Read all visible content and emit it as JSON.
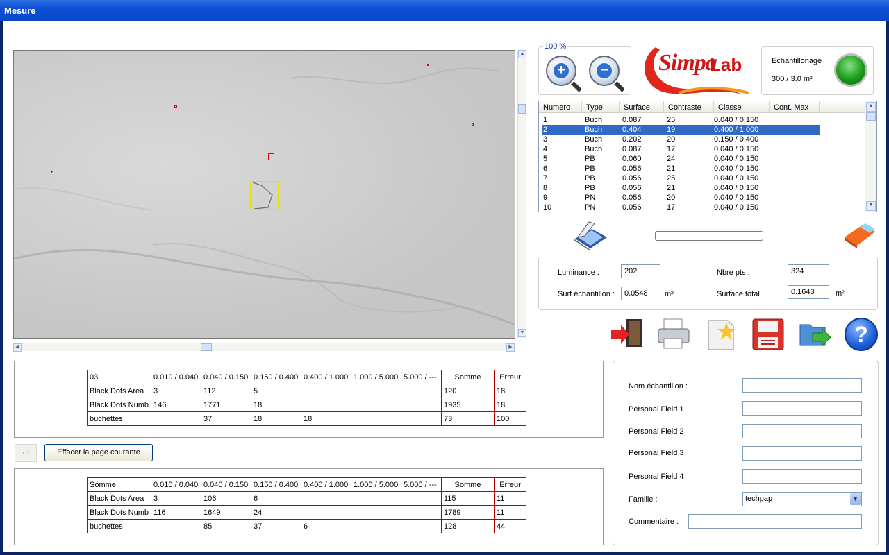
{
  "window": {
    "title": "Mesure"
  },
  "zoom": {
    "label": "100 %"
  },
  "logo": {
    "text1": "Simpa",
    "text2": "Lab"
  },
  "sampling": {
    "title": "Echantillonage",
    "value": "300 / 3.0 m²",
    "status_color": "#1c9c1c"
  },
  "results_list": {
    "columns": [
      "Numero",
      "Type",
      "Surface",
      "Contraste",
      "Classe",
      "Cont. Max"
    ],
    "selected_index": 1,
    "rows": [
      [
        "1",
        "Buch",
        "0.087",
        "25",
        "0.040 / 0.150",
        ""
      ],
      [
        "2",
        "Buch",
        "0.404",
        "19",
        "0.400 / 1.000",
        ""
      ],
      [
        "3",
        "Buch",
        "0.202",
        "20",
        "0.150 / 0.400",
        ""
      ],
      [
        "4",
        "Buch",
        "0.087",
        "17",
        "0.040 / 0.150",
        ""
      ],
      [
        "5",
        "PB",
        "0.060",
        "24",
        "0.040 / 0.150",
        ""
      ],
      [
        "6",
        "PB",
        "0.056",
        "21",
        "0.040 / 0.150",
        ""
      ],
      [
        "7",
        "PB",
        "0.056",
        "25",
        "0.040 / 0.150",
        ""
      ],
      [
        "8",
        "PB",
        "0.056",
        "21",
        "0.040 / 0.150",
        ""
      ],
      [
        "9",
        "PN",
        "0.056",
        "20",
        "0.040 / 0.150",
        ""
      ],
      [
        "10",
        "PN",
        "0.056",
        "17",
        "0.040 / 0.150",
        ""
      ]
    ]
  },
  "measures": {
    "luminance_label": "Luminance :",
    "luminance_value": "202",
    "nbre_pts_label": "Nbre pts :",
    "nbre_pts_value": "324",
    "surf_ech_label": "Surf échantillon :",
    "surf_ech_value": "0.0548",
    "surf_ech_unit": "m²",
    "surf_total_label": "Surface total",
    "surf_total_value": "0.1643",
    "surf_total_unit": "m²"
  },
  "toolbar": {
    "icons": [
      "exit-icon",
      "printer-icon",
      "new-document-icon",
      "save-floppy-icon",
      "export-folder-icon",
      "help-icon"
    ],
    "help_text": "?"
  },
  "table_current": {
    "header": [
      "03",
      "0.010 / 0.040",
      "0.040 / 0.150",
      "0.150 / 0.400",
      "0.400 / 1.000",
      "1.000 / 5.000",
      "5.000 / ---",
      "Somme",
      "Erreur"
    ],
    "rows": [
      [
        "Black Dots Area",
        "3",
        "112",
        "5",
        "",
        "",
        "",
        "120",
        "18"
      ],
      [
        "Black Dots Numb",
        "146",
        "1771",
        "18",
        "",
        "",
        "",
        "1935",
        "18"
      ],
      [
        "buchettes",
        "",
        "37",
        "18",
        "18",
        "",
        "",
        "73",
        "100"
      ]
    ]
  },
  "nav": {
    "prev": "‹",
    "next": "›"
  },
  "clear_button": {
    "label": "Effacer la page courante"
  },
  "table_total": {
    "header": [
      "Somme",
      "0.010 / 0.040",
      "0.040 / 0.150",
      "0.150 / 0.400",
      "0.400 / 1.000",
      "1.000 / 5.000",
      "5.000 / ---",
      "Somme",
      "Erreur"
    ],
    "rows": [
      [
        "Black Dots Area",
        "3",
        "106",
        "6",
        "",
        "",
        "",
        "115",
        "11"
      ],
      [
        "Black Dots Numb",
        "116",
        "1649",
        "24",
        "",
        "",
        "",
        "1789",
        "11"
      ],
      [
        "buchettes",
        "",
        "85",
        "37",
        "6",
        "",
        "",
        "128",
        "44"
      ]
    ]
  },
  "form": {
    "nom_label": "Nom échantillon :",
    "nom_value": "",
    "pf1_label": "Personal Field 1",
    "pf1_value": "",
    "pf2_label": "Personal Field 2",
    "pf2_value": "",
    "pf3_label": "Personal Field 3",
    "pf3_value": "",
    "pf4_label": "Personal Field 4",
    "pf4_value": "",
    "famille_label": "Famille :",
    "famille_value": "techpap",
    "commentaire_label": "Commentaire :",
    "commentaire_value": ""
  }
}
